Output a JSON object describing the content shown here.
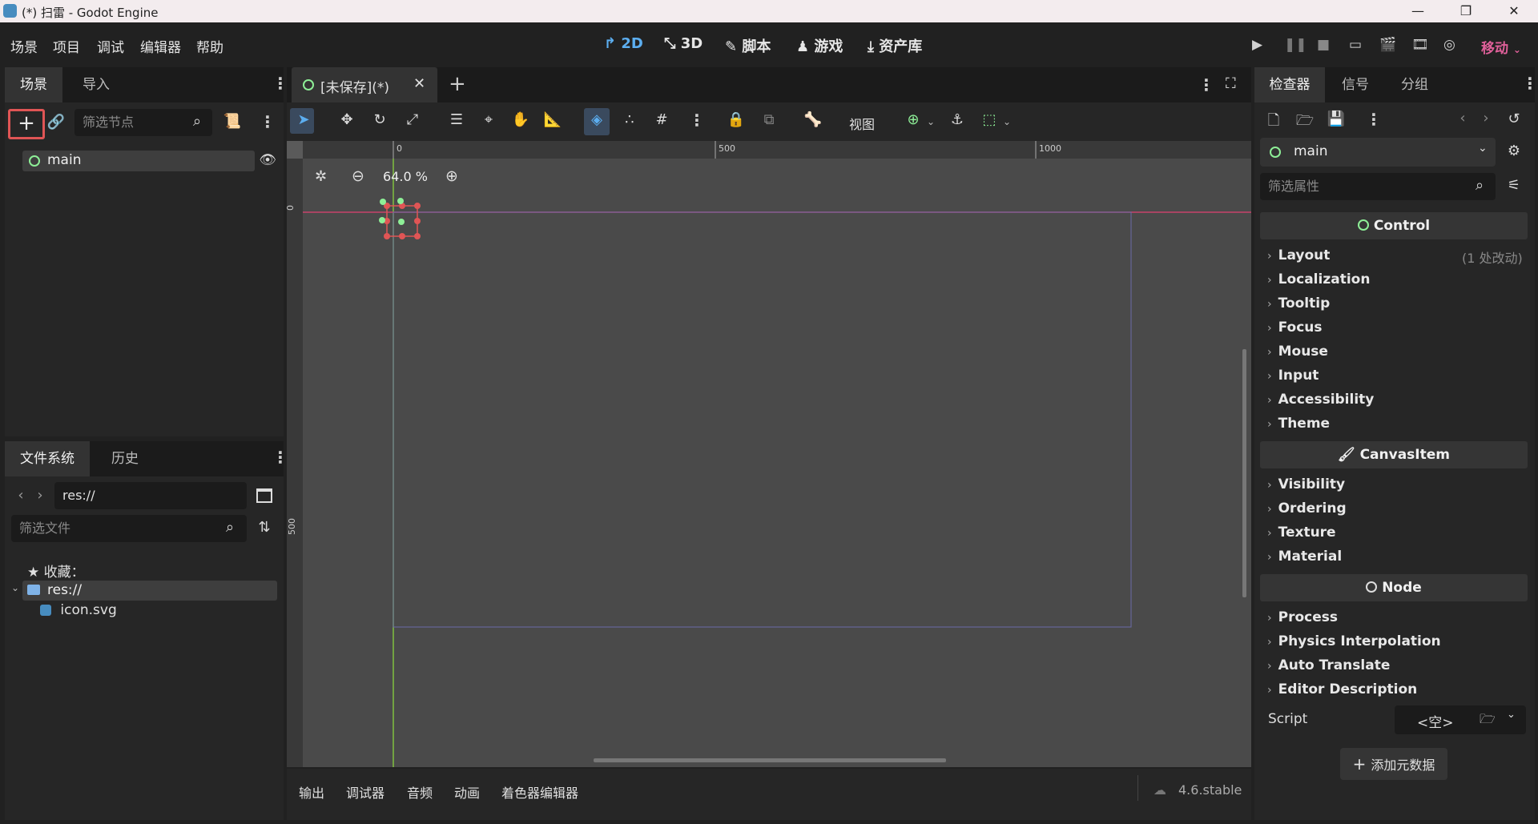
{
  "window": {
    "title": "(*) 扫雷 - Godot Engine",
    "minimize": "—",
    "maximize": "❐",
    "close": "✕"
  },
  "menubar": {
    "items": [
      "场景",
      "项目",
      "调试",
      "编辑器",
      "帮助"
    ],
    "modes": [
      {
        "icon": "↱",
        "label": "2D"
      },
      {
        "icon": "⤡",
        "label": "3D"
      },
      {
        "icon": "✎",
        "label": "脚本"
      },
      {
        "icon": "♟",
        "label": "游戏"
      },
      {
        "icon": "⤓",
        "label": "资产库"
      }
    ],
    "renderer": "移动"
  },
  "scene_dock": {
    "tabs": [
      "场景",
      "导入"
    ],
    "filter_placeholder": "筛选节点",
    "tree": [
      {
        "name": "main"
      }
    ]
  },
  "filesystem_dock": {
    "tabs": [
      "文件系统",
      "历史"
    ],
    "path": "res://",
    "filter_placeholder": "筛选文件",
    "favorites_label": "收藏：",
    "items": [
      {
        "name": "res://"
      },
      {
        "name": "icon.svg"
      }
    ]
  },
  "editor_tab": {
    "title": "[未保存](*)",
    "view_menu": "视图"
  },
  "viewport": {
    "zoom": "64.0 %",
    "ruler_h": [
      "0",
      "500",
      "1000"
    ],
    "ruler_v": [
      "0",
      "500"
    ]
  },
  "bottom_panel": {
    "tabs": [
      "输出",
      "调试器",
      "音频",
      "动画",
      "着色器编辑器"
    ],
    "version": "4.6.stable"
  },
  "inspector": {
    "tabs": [
      "检查器",
      "信号",
      "分组"
    ],
    "node_name": "main",
    "filter_placeholder": "筛选属性",
    "sections": [
      {
        "title": "Control",
        "props": [
          "Layout",
          "Localization",
          "Tooltip",
          "Focus",
          "Mouse",
          "Input",
          "Accessibility",
          "Theme"
        ]
      },
      {
        "title": "CanvasItem",
        "props": [
          "Visibility",
          "Ordering",
          "Texture",
          "Material"
        ]
      },
      {
        "title": "Node",
        "props": [
          "Process",
          "Physics Interpolation",
          "Auto Translate",
          "Editor Description"
        ]
      }
    ],
    "layout_changes": "(1 处改动)",
    "script_label": "Script",
    "script_value": "<空>",
    "add_metadata": "添加元数据"
  },
  "colors": {
    "accent": "#5caef0",
    "renderer": "#e0609a",
    "highlight_box": "#e05555",
    "node_green": "#8eef97"
  }
}
